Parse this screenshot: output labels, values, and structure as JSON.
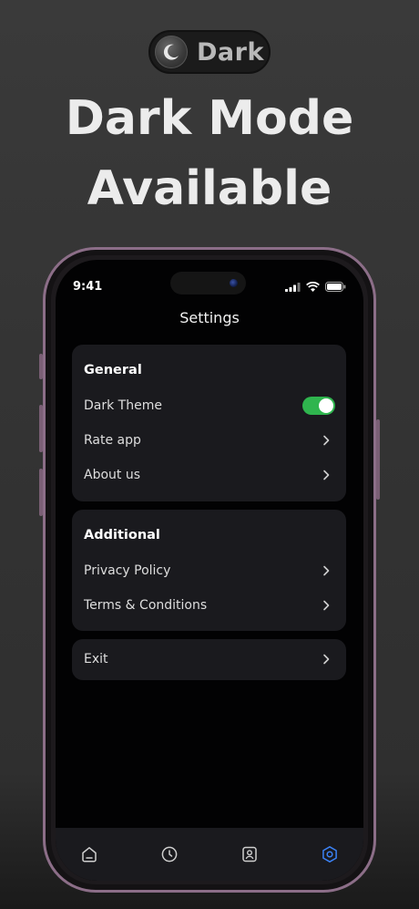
{
  "badge": {
    "label": "Dark",
    "icon": "moon-icon"
  },
  "headline": {
    "line1": "Dark Mode",
    "line2": "Available"
  },
  "status_bar": {
    "time": "9:41",
    "icons": [
      "signal-icon",
      "wifi-icon",
      "battery-icon"
    ]
  },
  "header": {
    "title": "Settings"
  },
  "sections": {
    "general": {
      "title": "General",
      "dark_theme": {
        "label": "Dark Theme",
        "enabled": true
      },
      "rate_app": {
        "label": "Rate app"
      },
      "about_us": {
        "label": "About us"
      }
    },
    "additional": {
      "title": "Additional",
      "privacy": {
        "label": "Privacy Policy"
      },
      "terms": {
        "label": "Terms & Conditions"
      }
    },
    "exit": {
      "label": "Exit"
    }
  },
  "tabbar": {
    "tabs": [
      {
        "icon": "home-icon",
        "active": false
      },
      {
        "icon": "clock-icon",
        "active": false
      },
      {
        "icon": "profile-icon",
        "active": false
      },
      {
        "icon": "settings-icon",
        "active": true
      }
    ],
    "active_color": "#3b82f6",
    "inactive_color": "#cfcfcf"
  },
  "colors": {
    "toggle_on": "#2fb54e",
    "frame": "#8c6e88",
    "card_bg": "#1a1a1e"
  }
}
